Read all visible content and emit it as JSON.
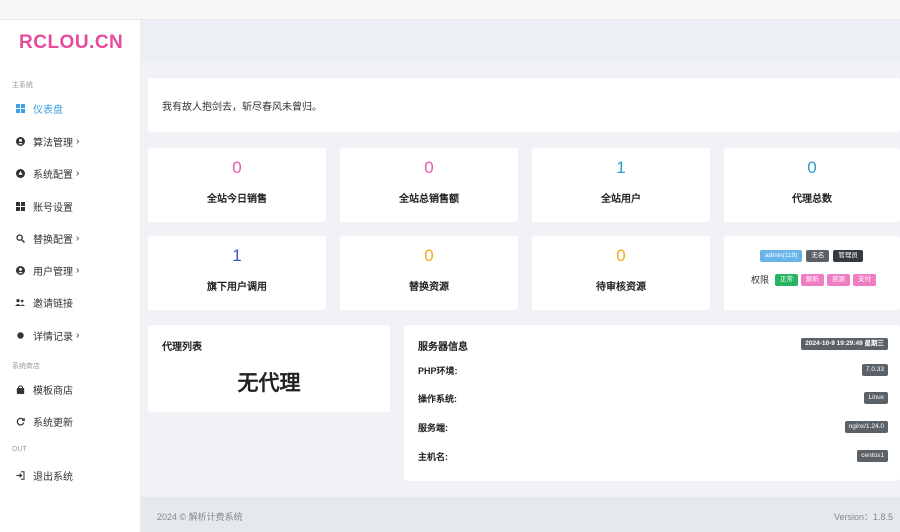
{
  "brand": {
    "logo": "RCLOU.CN",
    "color": "#e84a9c"
  },
  "sidebar": {
    "sections": {
      "main": "主系统",
      "shop": "系统商店",
      "out": "OUT"
    },
    "items": [
      {
        "label": "仪表盘",
        "icon": "dashboard-icon",
        "active": true,
        "chevron": ""
      },
      {
        "label": "算法管理",
        "icon": "algorithm-icon",
        "chevron": "›"
      },
      {
        "label": "系统配置",
        "icon": "config-icon",
        "chevron": "›"
      },
      {
        "label": "账号设置",
        "icon": "account-icon",
        "chevron": ""
      },
      {
        "label": "替换配置",
        "icon": "replace-icon",
        "chevron": "›"
      },
      {
        "label": "用户管理",
        "icon": "user-icon",
        "chevron": "›"
      },
      {
        "label": "邀请链接",
        "icon": "invite-icon",
        "chevron": ""
      },
      {
        "label": "详情记录",
        "icon": "record-icon",
        "chevron": "›"
      },
      {
        "label": "模板商店",
        "icon": "shop-icon",
        "chevron": ""
      },
      {
        "label": "系统更新",
        "icon": "refresh-icon",
        "chevron": ""
      },
      {
        "label": "退出系统",
        "icon": "logout-icon",
        "chevron": ""
      }
    ]
  },
  "quote": "我有故人抱剑去，斩尽春风未曾归。",
  "stats": [
    {
      "value": "0",
      "label": "全站今日销售",
      "color": "#e85aa8"
    },
    {
      "value": "0",
      "label": "全站总销售额",
      "color": "#e85aa8"
    },
    {
      "value": "1",
      "label": "全站用户",
      "color": "#2ba0c8"
    },
    {
      "value": "0",
      "label": "代理总数",
      "color": "#2ba0c8"
    },
    {
      "value": "1",
      "label": "旗下用户调用",
      "color": "#3a56c8"
    },
    {
      "value": "0",
      "label": "替换资源",
      "color": "#f0a91e"
    },
    {
      "value": "0",
      "label": "待审核资源",
      "color": "#f0a91e"
    }
  ],
  "user_card": {
    "badges": [
      {
        "text": "admin(119)",
        "color": "#6ab4ec"
      },
      {
        "text": "无名",
        "color": "#5a6268"
      },
      {
        "text": "管理员",
        "color": "#343a40"
      }
    ],
    "perm_label": "权限",
    "perms": [
      {
        "text": "正常",
        "color": "#28b463"
      },
      {
        "text": "解析",
        "color": "#f07cc4"
      },
      {
        "text": "资源",
        "color": "#f07cc4"
      },
      {
        "text": "支付",
        "color": "#f07cc4"
      }
    ]
  },
  "agents": {
    "title": "代理列表",
    "empty": "无代理"
  },
  "server": {
    "title": "服务器信息",
    "time": "2024-10-9 19:29:49 星期三",
    "rows": [
      {
        "label": "PHP环境:",
        "value": "7.0.33"
      },
      {
        "label": "操作系统:",
        "value": "Linux"
      },
      {
        "label": "服务端:",
        "value": "nginx/1.24.0"
      },
      {
        "label": "主机名:",
        "value": "centos1"
      }
    ]
  },
  "footer": {
    "copyright": "2024 © 解析计费系统",
    "version": "Version：1.8.5"
  }
}
